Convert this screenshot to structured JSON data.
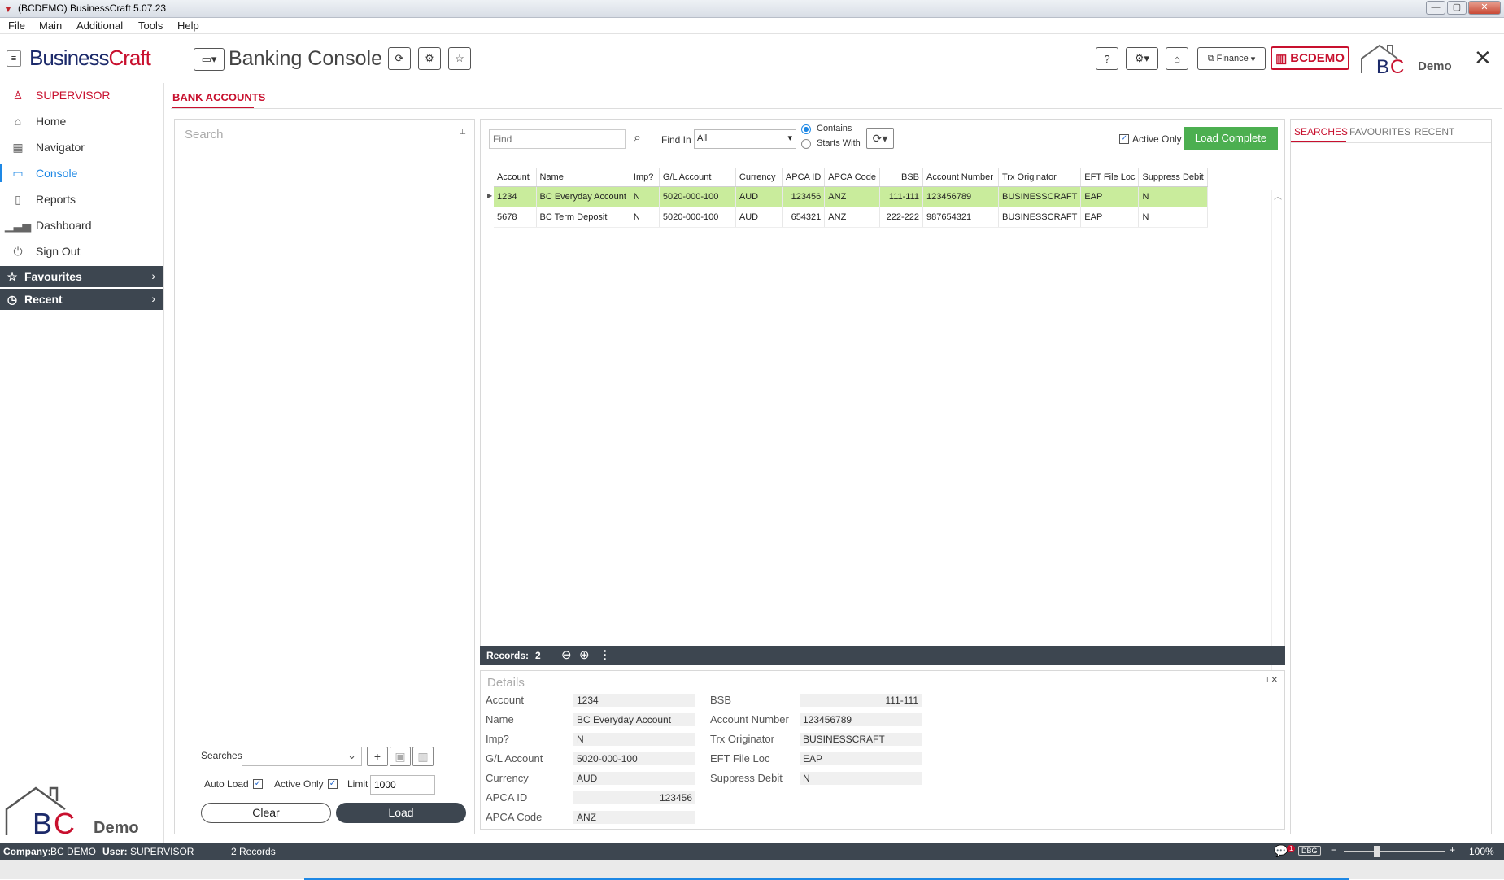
{
  "window": {
    "title": "(BCDEMO) BusinessCraft  5.07.23"
  },
  "menu": [
    "File",
    "Main",
    "Additional",
    "Tools",
    "Help"
  ],
  "header": {
    "logo_a": "Business",
    "logo_b": "Craft",
    "page_title": "Banking Console",
    "finance_label": "Finance",
    "company_badge": "BCDEMO",
    "demo_label": "Demo"
  },
  "sidebar": {
    "user": "SUPERVISOR",
    "items": [
      "Home",
      "Navigator",
      "Console",
      "Reports",
      "Dashboard",
      "Sign Out"
    ],
    "favourites": "Favourites",
    "recent": "Recent",
    "demo_label": "Demo"
  },
  "tab": {
    "label": "BANK ACCOUNTS"
  },
  "search_panel": {
    "placeholder": "Search",
    "searches_label": "Searches",
    "auto_load_label": "Auto Load",
    "active_only_label": "Active Only",
    "limit_label": "Limit",
    "limit_value": "1000",
    "clear_label": "Clear",
    "load_label": "Load"
  },
  "filter": {
    "find_placeholder": "Find",
    "find_in_label": "Find In",
    "find_in_value": "All",
    "contains_label": "Contains",
    "starts_with_label": "Starts With",
    "active_only_label": "Active Only",
    "load_complete_label": "Load Complete"
  },
  "grid": {
    "columns": [
      "Account",
      "Name",
      "Imp?",
      "G/L Account",
      "Currency",
      "APCA ID",
      "APCA Code",
      "BSB",
      "Account Number",
      "Trx Originator",
      "EFT File Loc",
      "Suppress Debit"
    ],
    "rows": [
      [
        "1234",
        "BC Everyday Account",
        "N",
        "5020-000-100",
        "AUD",
        "123456",
        "ANZ",
        "111-111",
        "123456789",
        "BUSINESSCRAFT",
        "EAP",
        "N"
      ],
      [
        "5678",
        "BC Term Deposit",
        "N",
        "5020-000-100",
        "AUD",
        "654321",
        "ANZ",
        "222-222",
        "987654321",
        "BUSINESSCRAFT",
        "EAP",
        "N"
      ]
    ]
  },
  "records": {
    "label": "Records:",
    "count": "2"
  },
  "details": {
    "title": "Details",
    "left": [
      {
        "label": "Account",
        "value": "1234"
      },
      {
        "label": "Name",
        "value": "BC Everyday Account"
      },
      {
        "label": "Imp?",
        "value": "N"
      },
      {
        "label": "G/L Account",
        "value": "5020-000-100"
      },
      {
        "label": "Currency",
        "value": "AUD"
      },
      {
        "label": "APCA ID",
        "value": "123456"
      },
      {
        "label": "APCA Code",
        "value": "ANZ"
      }
    ],
    "right": [
      {
        "label": "BSB",
        "value": "111-111"
      },
      {
        "label": "Account Number",
        "value": "123456789"
      },
      {
        "label": "Trx Originator",
        "value": "BUSINESSCRAFT"
      },
      {
        "label": "EFT File Loc",
        "value": "EAP"
      },
      {
        "label": "Suppress Debit",
        "value": "N"
      }
    ]
  },
  "right_panel": {
    "tabs": [
      "SEARCHES",
      "FAVOURITES",
      "RECENT"
    ]
  },
  "status": {
    "company_label": "Company:",
    "company": "BC DEMO",
    "user_label": "User:",
    "user": "SUPERVISOR",
    "records": "2 Records",
    "dbg": "DBG",
    "notif_count": "1",
    "zoom": "100%"
  },
  "colors": {
    "accent_red": "#c8102e",
    "accent_blue": "#1e88e5",
    "dark_bar": "#3d4650",
    "load_complete_green": "#4caf50",
    "selected_row": "#c9ec9c"
  }
}
